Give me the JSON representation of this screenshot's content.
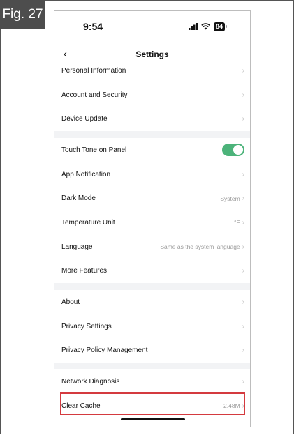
{
  "figure": {
    "label": "Fig. 27"
  },
  "status_bar": {
    "time": "9:54",
    "battery": "84",
    "icons": [
      "signal-icon",
      "wifi-icon",
      "battery-icon"
    ]
  },
  "nav": {
    "back_icon": "chevron-left-icon",
    "title": "Settings"
  },
  "groups": [
    {
      "items": [
        {
          "label": "Personal Information",
          "value": ""
        },
        {
          "label": "Account and Security",
          "value": ""
        },
        {
          "label": "Device Update",
          "value": ""
        }
      ]
    },
    {
      "items": [
        {
          "label": "Touch Tone on Panel",
          "value": "",
          "toggle": true
        },
        {
          "label": "App Notification",
          "value": ""
        },
        {
          "label": "Dark Mode",
          "value": "System"
        },
        {
          "label": "Temperature Unit",
          "value": "°F"
        },
        {
          "label": "Language",
          "value": "Same as the system language"
        },
        {
          "label": "More Features",
          "value": ""
        }
      ]
    },
    {
      "items": [
        {
          "label": "About",
          "value": ""
        },
        {
          "label": "Privacy Settings",
          "value": ""
        },
        {
          "label": "Privacy Policy Management",
          "value": ""
        }
      ]
    },
    {
      "items": [
        {
          "label": "Network Diagnosis",
          "value": ""
        },
        {
          "label": "Clear Cache",
          "value": "2.48M",
          "highlighted": true
        }
      ]
    }
  ],
  "colors": {
    "toggle_on": "#4cb37a",
    "highlight_border": "#d43a3f",
    "group_gap": "#f2f3f5",
    "figure_label_bg": "#4d4d4d"
  }
}
